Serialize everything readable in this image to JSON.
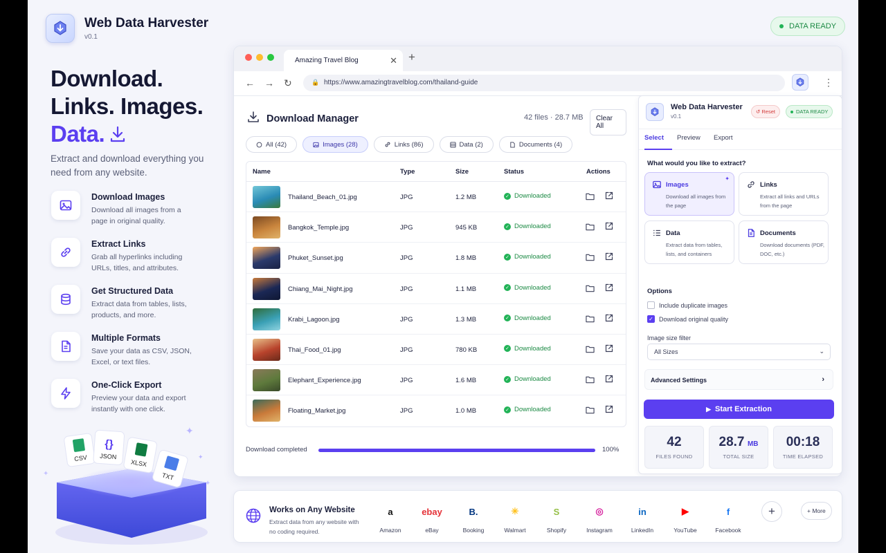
{
  "app": {
    "title": "Web Data Harvester",
    "version": "v0.1",
    "status_badge": "DATA READY"
  },
  "hero": {
    "line1": "Download.",
    "line2": "Links. Images.",
    "line3": "Data.",
    "subtitle": "Extract and download everything you need from any website."
  },
  "features": [
    {
      "icon": "image-icon",
      "title": "Download Images",
      "desc": "Download all images from a page in original quality."
    },
    {
      "icon": "link-icon",
      "title": "Extract Links",
      "desc": "Grab all hyperlinks including URLs, titles, and attributes."
    },
    {
      "icon": "database-icon",
      "title": "Get Structured Data",
      "desc": "Extract data from tables, lists, products, and more."
    },
    {
      "icon": "document-icon",
      "title": "Multiple Formats",
      "desc": "Save your data as CSV, JSON, Excel, or text files."
    },
    {
      "icon": "lightning-icon",
      "title": "One-Click Export",
      "desc": "Preview your data and export instantly with one click."
    }
  ],
  "illustration": {
    "labels": [
      "CSV",
      "JSON",
      "XLSX",
      "TXT"
    ]
  },
  "browser": {
    "tab_title": "Amazing Travel Blog",
    "url": "https://www.amazingtravelblog.com/thailand-guide"
  },
  "download_manager": {
    "title": "Download Manager",
    "stats": "42 files · 28.7 MB",
    "clear_label": "Clear All",
    "filters": [
      "All (42)",
      "Images (28)",
      "Links (86)",
      "Data (2)",
      "Documents (4)"
    ],
    "columns": [
      "Name",
      "Type",
      "Size",
      "Status",
      "Actions"
    ],
    "rows": [
      {
        "name": "Thailand_Beach_01.jpg",
        "type": "JPG",
        "size": "1.2 MB",
        "status": "Downloaded",
        "thumb": [
          "#2a8bb5",
          "#73c7d8",
          "#3a7a3c"
        ]
      },
      {
        "name": "Bangkok_Temple.jpg",
        "type": "JPG",
        "size": "945 KB",
        "status": "Downloaded",
        "thumb": [
          "#c9853d",
          "#7c4a22",
          "#e0b36a"
        ]
      },
      {
        "name": "Phuket_Sunset.jpg",
        "type": "JPG",
        "size": "1.8 MB",
        "status": "Downloaded",
        "thumb": [
          "#2b3a6b",
          "#f2a65a",
          "#1a2244"
        ]
      },
      {
        "name": "Chiang_Mai_Night.jpg",
        "type": "JPG",
        "size": "1.1 MB",
        "status": "Downloaded",
        "thumb": [
          "#1b2855",
          "#c87a3a",
          "#0f1733"
        ]
      },
      {
        "name": "Krabi_Lagoon.jpg",
        "type": "JPG",
        "size": "1.3 MB",
        "status": "Downloaded",
        "thumb": [
          "#3aa0b5",
          "#2f6d3a",
          "#8fd3e0"
        ]
      },
      {
        "name": "Thai_Food_01.jpg",
        "type": "JPG",
        "size": "780 KB",
        "status": "Downloaded",
        "thumb": [
          "#b8432c",
          "#e8c08a",
          "#6a2a1a"
        ]
      },
      {
        "name": "Elephant_Experience.jpg",
        "type": "JPG",
        "size": "1.6 MB",
        "status": "Downloaded",
        "thumb": [
          "#5e7a3c",
          "#8a7a5a",
          "#3a4a2a"
        ]
      },
      {
        "name": "Floating_Market.jpg",
        "type": "JPG",
        "size": "1.0 MB",
        "status": "Downloaded",
        "thumb": [
          "#c97a3a",
          "#3a6a5a",
          "#e0b36a"
        ]
      }
    ],
    "progress_label": "Download completed",
    "progress_value": 1.0,
    "progress_pct": "100%"
  },
  "panel": {
    "title": "Web Data Harvester",
    "version": "v0.1",
    "reset_label": "Reset",
    "ready_label": "DATA READY",
    "tabs": [
      "Select",
      "Preview",
      "Export"
    ],
    "question": "What would you like to extract?",
    "options": [
      {
        "icon": "image-icon",
        "title": "Images",
        "desc": "Download all images from the page"
      },
      {
        "icon": "link-icon",
        "title": "Links",
        "desc": "Extract all links and URLs from the page"
      },
      {
        "icon": "list-icon",
        "title": "Data",
        "desc": "Extract data from tables, lists, and containers"
      },
      {
        "icon": "document-icon",
        "title": "Documents",
        "desc": "Download documents (PDF, DOC, etc.)"
      }
    ],
    "options_title": "Options",
    "checkbox1": "Include duplicate images",
    "checkbox2": "Download original quality",
    "size_filter_label": "Image size filter",
    "size_filter_value": "All Sizes",
    "advanced_label": "Advanced Settings",
    "start_label": "Start Extraction",
    "stats": [
      {
        "value": "42",
        "unit": "",
        "label": "FILES FOUND"
      },
      {
        "value": "28.7",
        "unit": "MB",
        "label": "TOTAL SIZE"
      },
      {
        "value": "00:18",
        "unit": "",
        "label": "TIME ELAPSED"
      }
    ]
  },
  "works": {
    "title": "Works on Any Website",
    "desc": "Extract data from any website with no coding required.",
    "sites": [
      {
        "name": "Amazon",
        "glyph": "a",
        "color": "#111111"
      },
      {
        "name": "eBay",
        "glyph": "ebay",
        "color": "#e53238"
      },
      {
        "name": "Booking",
        "glyph": "B.",
        "color": "#003580"
      },
      {
        "name": "Walmart",
        "glyph": "✳",
        "color": "#ffc220"
      },
      {
        "name": "Shopify",
        "glyph": "S",
        "color": "#95bf47"
      },
      {
        "name": "Instagram",
        "glyph": "◎",
        "color": "#d6249f"
      },
      {
        "name": "LinkedIn",
        "glyph": "in",
        "color": "#0a66c2"
      },
      {
        "name": "YouTube",
        "glyph": "▶",
        "color": "#ff0000"
      },
      {
        "name": "Facebook",
        "glyph": "f",
        "color": "#1877f2"
      }
    ],
    "more_label": "+ More"
  }
}
